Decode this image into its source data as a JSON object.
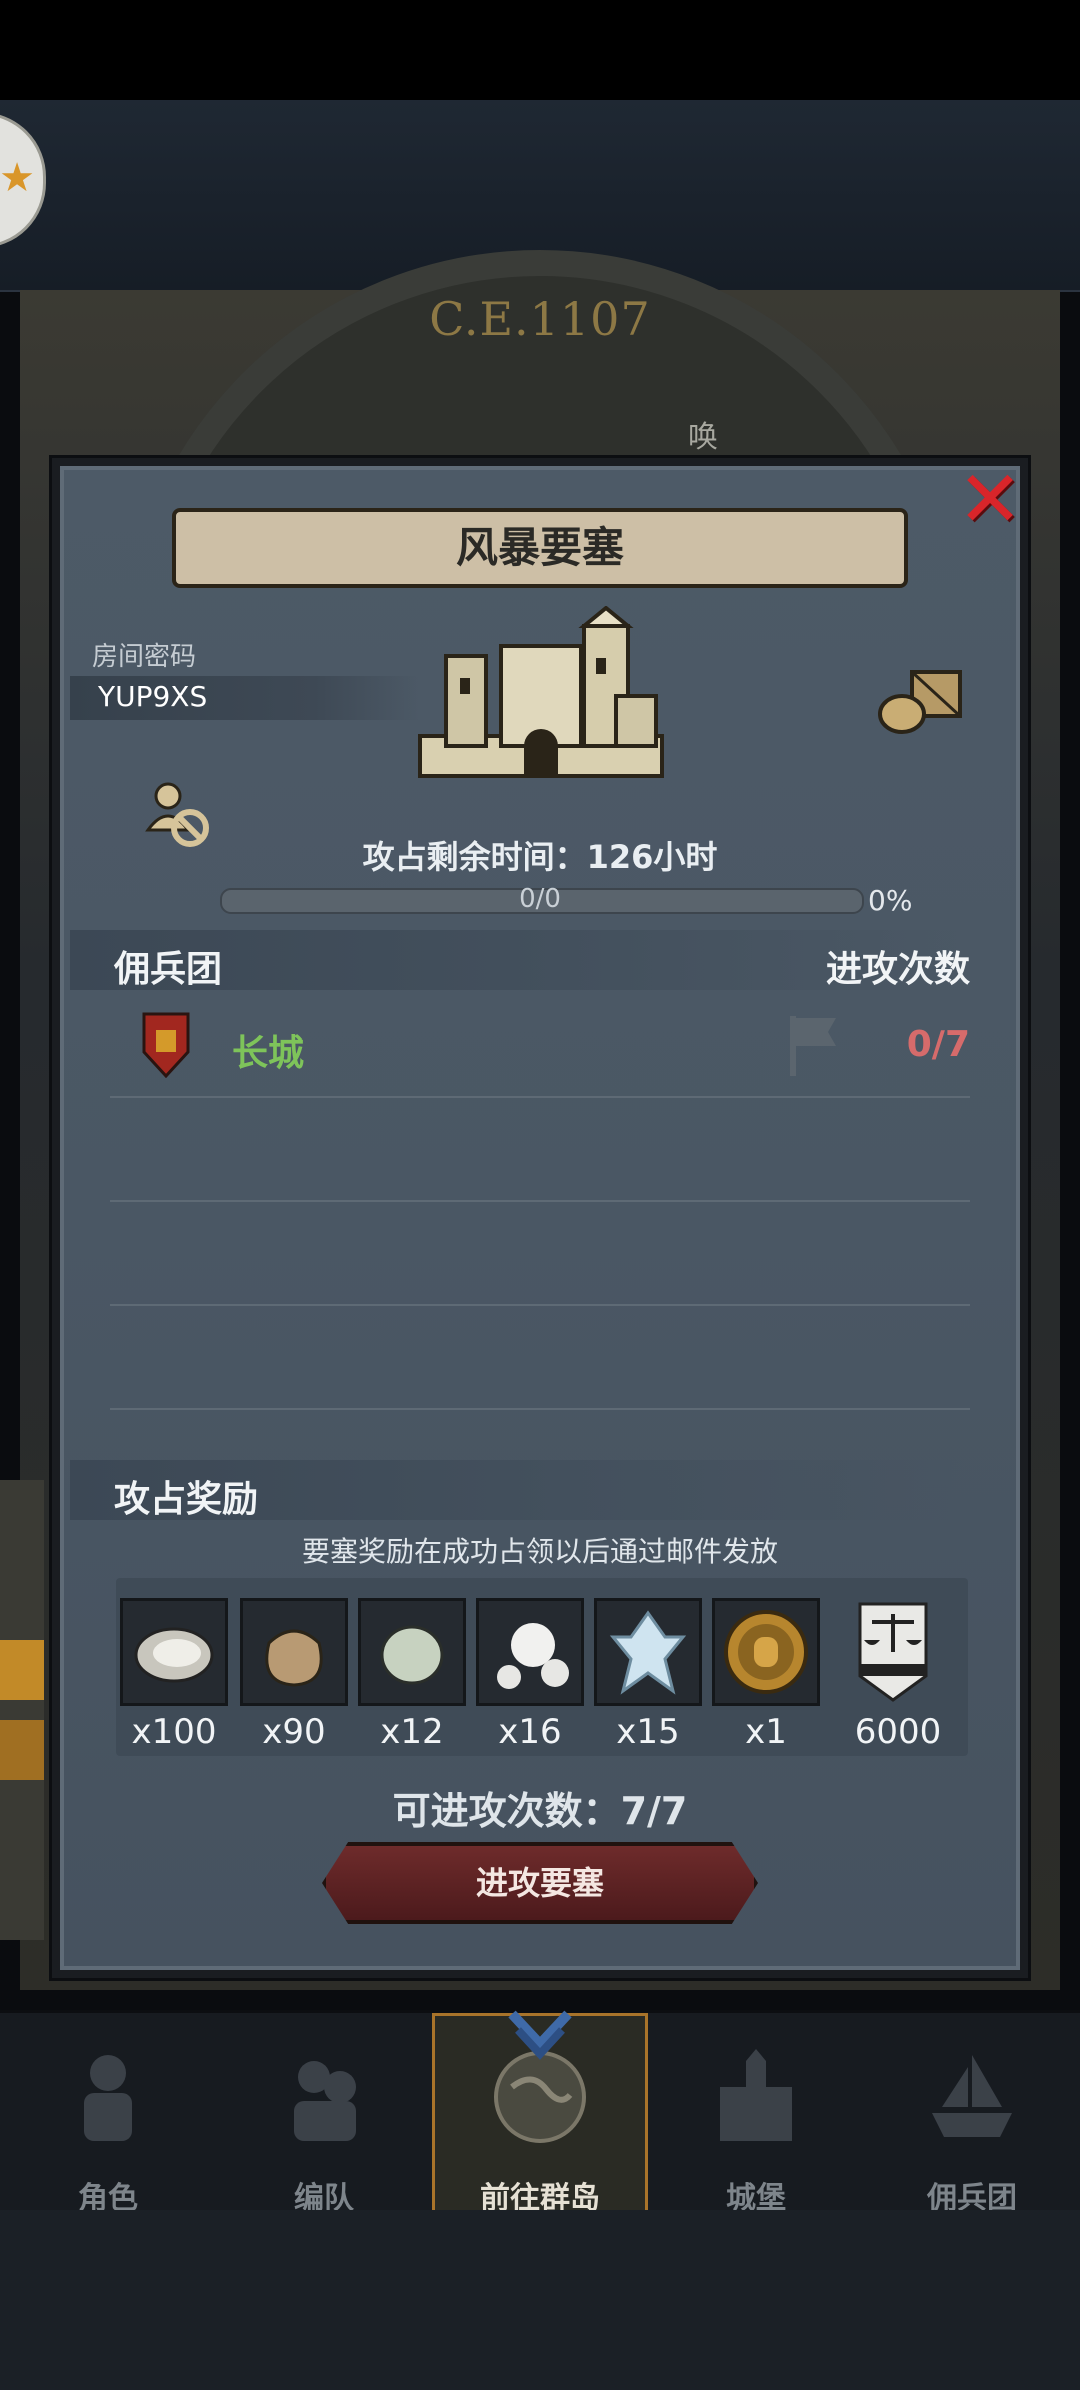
{
  "background": {
    "era": "C.E.1107",
    "mini_label": "唤"
  },
  "dialog": {
    "title": "风暴要塞",
    "room_password_label": "房间密码",
    "room_password": "YUP9XS",
    "remaining_time": "攻占剩余时间：126小时",
    "progress": {
      "text": "0/0",
      "percent_label": "0%",
      "fraction": 0
    }
  },
  "mercenary_section": {
    "title": "佣兵团",
    "attacks_header": "进攻次数",
    "guilds": [
      {
        "name": "长城",
        "attacks": "0/7"
      }
    ]
  },
  "rewards_section": {
    "title": "攻占奖励",
    "note": "要塞奖励在成功占领以后通过邮件发放",
    "items": [
      {
        "icon": "oyster-icon",
        "qty": "x100"
      },
      {
        "icon": "pouch-icon",
        "qty": "x90"
      },
      {
        "icon": "pale-stone-icon",
        "qty": "x12"
      },
      {
        "icon": "pearls-icon",
        "qty": "x16"
      },
      {
        "icon": "crystal-icon",
        "qty": "x15"
      },
      {
        "icon": "knight-medal-icon",
        "qty": "x1"
      },
      {
        "icon": "scales-banner-icon",
        "qty": "6000"
      }
    ]
  },
  "attacks_available": "可进攻次数：7/7",
  "attack_button": "进攻要塞",
  "nav": [
    {
      "label": "角色"
    },
    {
      "label": "编队"
    },
    {
      "label": "前往群岛",
      "active": true
    },
    {
      "label": "城堡"
    },
    {
      "label": "佣兵团"
    }
  ],
  "colors": {
    "guild_name": "#7ec45a",
    "attack_count": "#d66b6b",
    "close": "#d9252a",
    "nav_active_border": "#a9742a"
  }
}
